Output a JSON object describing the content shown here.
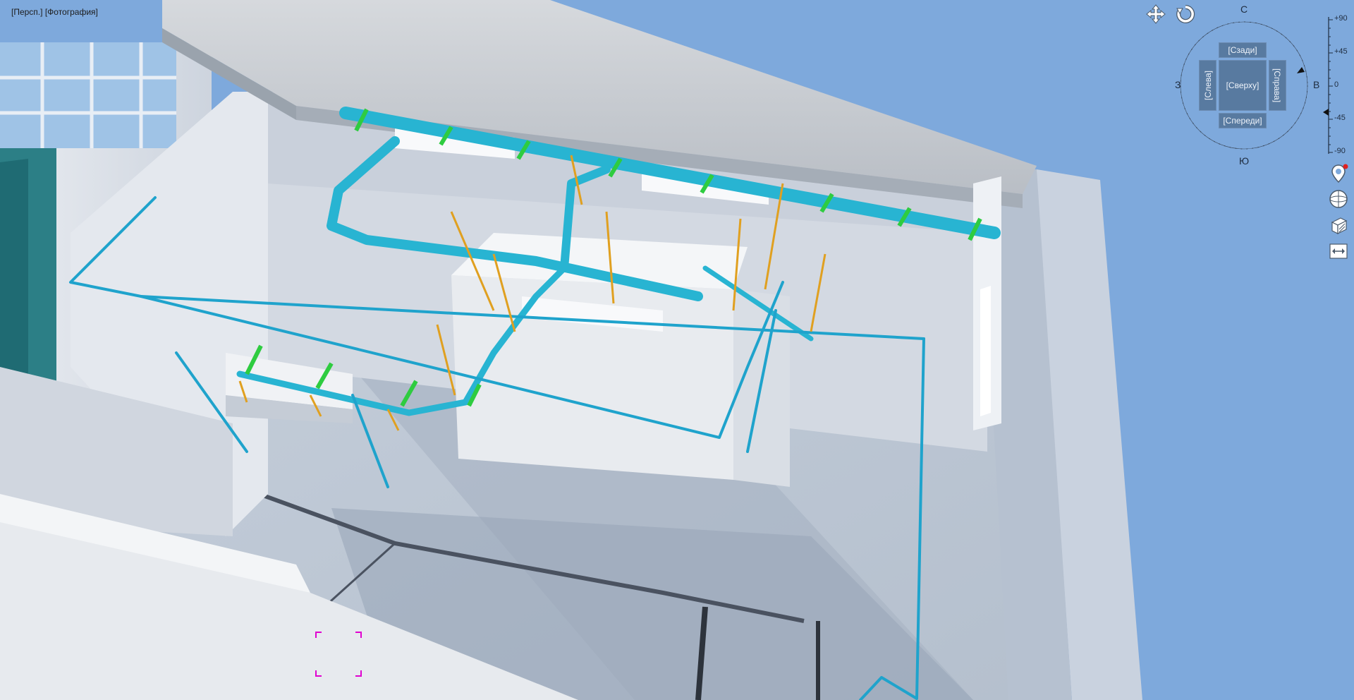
{
  "viewport": {
    "projection_label": "[Персп.]",
    "style_label": "[Фотография]"
  },
  "navigation": {
    "pan_icon": "pan-move-icon",
    "orbit_icon": "orbit-rotate-icon"
  },
  "compass": {
    "north": "С",
    "south": "Ю",
    "west": "З",
    "east": "В"
  },
  "view_cube": {
    "top": "[Сверху]",
    "back": "[Сзади]",
    "front": "[Спереди]",
    "left": "[Слева]",
    "right": "[Справа]"
  },
  "pitch_ruler": {
    "ticks": [
      "+90",
      "+45",
      "0",
      "-45",
      "-90"
    ]
  },
  "side_tools": [
    {
      "icon": "location-pin-icon"
    },
    {
      "icon": "sphere-view-icon"
    },
    {
      "icon": "section-box-icon"
    },
    {
      "icon": "fit-width-icon"
    }
  ],
  "colors": {
    "sky": "#7ea9dc",
    "pipe": "#28b4d2",
    "hanger_green": "#2ecc40",
    "hanger_orange": "#e0a020",
    "crosshair": "#e000d0",
    "cube_face": "#587aa0"
  }
}
